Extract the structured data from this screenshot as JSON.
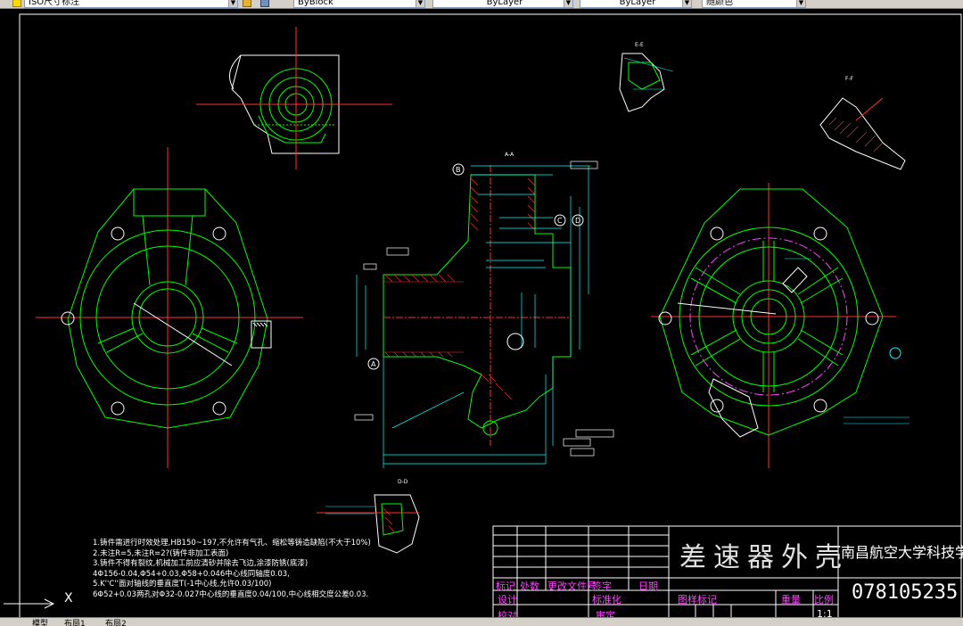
{
  "toolbar": {
    "style_combo": "ISO尺寸标注",
    "color_combo": "ByBlock",
    "linetype_combo": "ByLayer",
    "lineweight_combo": "ByLayer",
    "plotstyle_combo": "随颜色"
  },
  "drawing": {
    "section_labels": {
      "aa": "A-A",
      "ee": "E-E",
      "ff": "F-F",
      "dd": "D-D"
    },
    "datum_labels": [
      "B",
      "C",
      "D",
      "A"
    ]
  },
  "title_block": {
    "part_name": "差速器外壳",
    "school": "南昌航空大学科技学院",
    "drawing_number": "078105235",
    "row_headers": [
      "标记",
      "处数",
      "更改文件号",
      "签字",
      "日期"
    ],
    "row2": [
      "设计",
      "标准化",
      "图样标记",
      "重量",
      "比例"
    ],
    "row3": [
      "校对",
      "审定"
    ],
    "scale": "1:1"
  },
  "notes": [
    "1.铸件需进行时效处理,HB150~197,不允许有气孔、缩松等铸造缺陷(不大于10%)",
    "2.未注R=5,未注R=2?(铸件非加工表面)",
    "3.铸件不得有裂纹,机械加工前应清砂并除去飞边,涂漆防锈(底漆)",
    "4Φ156-0.04,Φ54+0.03,Φ58+0.046中心线同轴度0.03,",
    "5.K''C''面对轴线的垂直度T(-1中心线,允许0.03/100)",
    "6Φ52+0.03两孔对Φ32-0.027中心线的垂直度0.04/100,中心线相交度公差0.03."
  ],
  "ucs": {
    "x_label": "X"
  },
  "tabs": [
    "模型",
    "布局1",
    "布局2"
  ]
}
